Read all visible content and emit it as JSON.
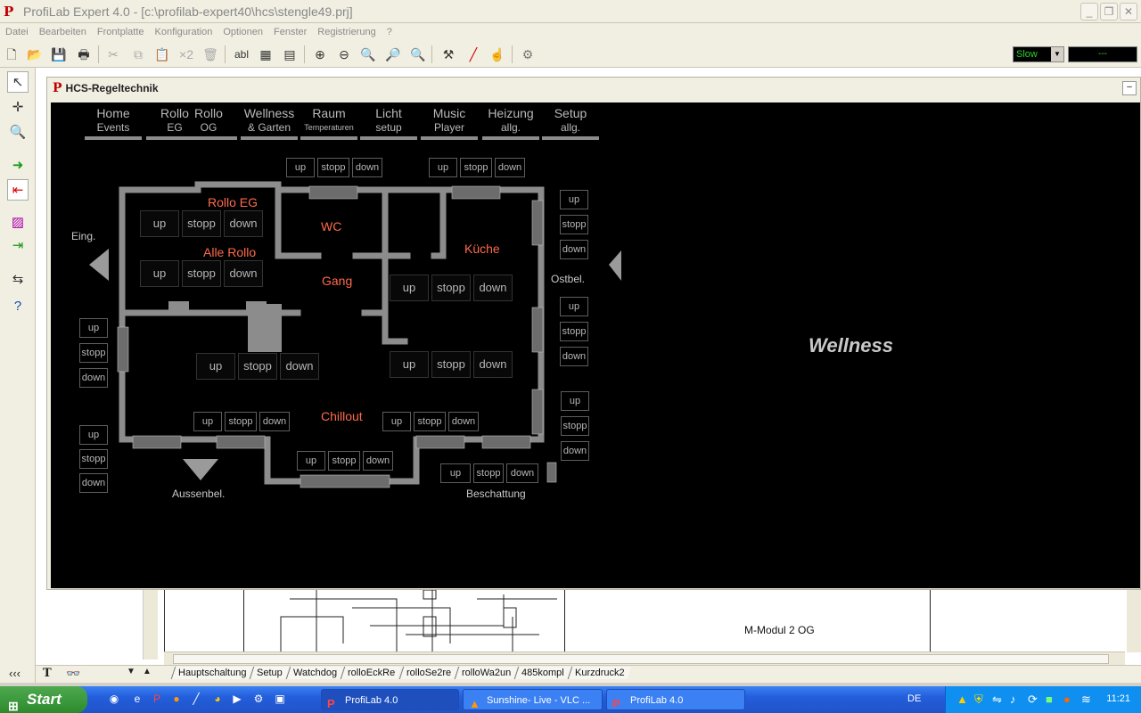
{
  "window": {
    "title": "ProfiLab Expert 4.0 - [c:\\profilab-expert40\\hcs\\stengle49.prj]",
    "logo": "P"
  },
  "menu": [
    "Datei",
    "Bearbeiten",
    "Frontplatte",
    "Konfiguration",
    "Optionen",
    "Fenster",
    "Registrierung",
    "?"
  ],
  "toolbar": {
    "speed": "Slow",
    "lcd": "---",
    "tb_x2": "×2",
    "tb_abl": "abl"
  },
  "mdi": {
    "title": "HCS-Regeltechnik"
  },
  "nav": [
    {
      "l1": "Home",
      "l2": "Events"
    },
    {
      "l1": "Rollo",
      "l2": "EG"
    },
    {
      "l1": "Rollo",
      "l2": "OG"
    },
    {
      "l1": "Wellness",
      "l2": "&  Garten"
    },
    {
      "l1": "Raum",
      "l2": "Temperaturen"
    },
    {
      "l1": "Licht",
      "l2": "setup"
    },
    {
      "l1": "Music",
      "l2": "Player"
    },
    {
      "l1": "Heizung",
      "l2": "allg."
    },
    {
      "l1": "Setup",
      "l2": "allg."
    }
  ],
  "rooms": {
    "rollo_eg": "Rollo   EG",
    "alle_rollo": "Alle   Rollo",
    "wc": "WC",
    "gang": "Gang",
    "kueche": "Küche",
    "chillout": "Chillout"
  },
  "labels": {
    "eing": "Eing.",
    "ostbel": "Ostbel.",
    "aussenbel": "Aussenbel.",
    "beschattung": "Beschattung",
    "wellness": "Wellness"
  },
  "btn": {
    "up": "up",
    "stopp": "stopp",
    "down": "down"
  },
  "sheet": {
    "modul": "M-Modul 2 OG"
  },
  "tabs": [
    "Hauptschaltung",
    "Setup",
    "Watchdog",
    "rolloEckRe",
    "rolloSe2re",
    "rolloWa2un",
    "485kompl",
    "Kurzdruck2"
  ],
  "taskbar": {
    "start": "Start",
    "tasks": [
      "ProfiLab 4.0",
      "Sunshine- Live - VLC ...",
      "ProfiLab 4.0"
    ],
    "lang": "DE",
    "clock": "11:21"
  },
  "colors": {
    "room_text": "#ff6a4a",
    "panel_bg": "#000000",
    "wall": "#8c8c8c"
  }
}
